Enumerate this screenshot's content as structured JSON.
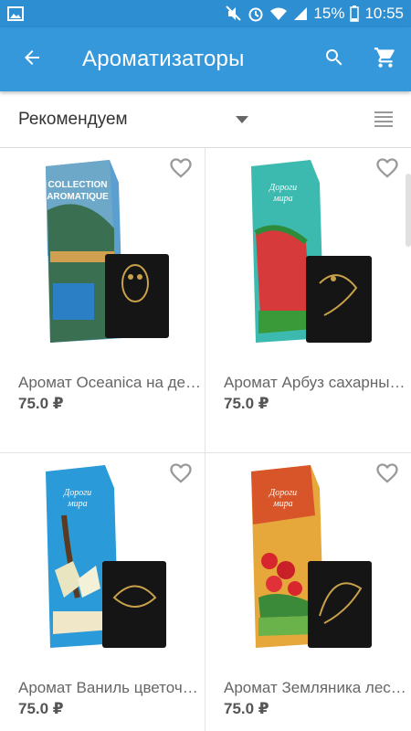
{
  "status_bar": {
    "battery": "15%",
    "time": "10:55",
    "icons": [
      "image-icon",
      "mute-icon",
      "alarm-icon",
      "wifi-icon",
      "signal-icon",
      "battery-icon"
    ]
  },
  "app_bar": {
    "title": "Ароматизаторы",
    "color": "#3498db"
  },
  "filter": {
    "sort_label": "Рекомендуем"
  },
  "products": [
    {
      "name": "Аромат Oceanica на де…",
      "price": "75.0 ₽",
      "pack_color": "#4a8fc4",
      "pack_title": "COLLECTION AROMATIQUE"
    },
    {
      "name": "Аромат Арбуз сахарны…",
      "price": "75.0 ₽",
      "pack_color": "#36b3a8",
      "pack_title": "Дороги мира"
    },
    {
      "name": "Аромат Ваниль цветоч…",
      "price": "75.0 ₽",
      "pack_color": "#2a9ad8",
      "pack_title": "Дороги мира"
    },
    {
      "name": "Аромат Земляника лес…",
      "price": "75.0 ₽",
      "pack_color": "#d8702a",
      "pack_title": "Дороги мира"
    }
  ]
}
